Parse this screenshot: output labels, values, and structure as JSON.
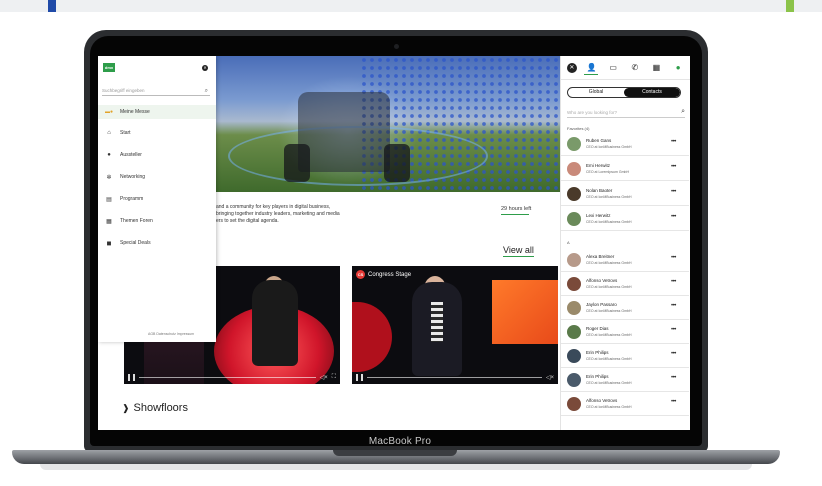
{
  "device": {
    "label": "MacBook Pro"
  },
  "menu": {
    "search_placeholder": "Suchbegriff eingeben",
    "items": [
      {
        "label": "Meine Messe",
        "icon": "ticket-icon"
      },
      {
        "label": "Start",
        "icon": "home-icon"
      },
      {
        "label": "Aussteller",
        "icon": "location-pin-icon"
      },
      {
        "label": "Networking",
        "icon": "network-icon"
      },
      {
        "label": "Programm",
        "icon": "document-icon"
      },
      {
        "label": "Themen Foren",
        "icon": "building-icon"
      },
      {
        "label": "Special Deals",
        "icon": "gift-icon"
      }
    ],
    "footer": "AGB  Datenschutz  Impressum"
  },
  "main": {
    "intro_lines": [
      "and a community for key players in digital business,",
      "bringing together industry leaders, marketing and media",
      "ers to set the digital agenda."
    ],
    "hours_left": "29 hours left",
    "view_all": "View all",
    "videos": [
      {
        "badge": ""
      },
      {
        "badge_code": "CS",
        "badge": "Congress Stage"
      }
    ],
    "section_title": "Showfloors"
  },
  "right_panel": {
    "toggle": {
      "global": "Global",
      "contacts": "Contacts"
    },
    "search_placeholder": "Who are you looking for?",
    "favorites_label": "Favorites (4)",
    "a_label": "A",
    "favorites": [
      {
        "name": "Ruben Gans",
        "company": "CEO at IonMBusiness GmbH",
        "avatar": "#7a9a6a"
      },
      {
        "name": "Emi Herwitz",
        "company": "CEO at LoremIpsum GmbH",
        "avatar": "#c98a7a"
      },
      {
        "name": "Nolan Baoter",
        "company": "CEO at IonMBusiness GmbH",
        "avatar": "#4a3a2a"
      },
      {
        "name": "Lexi Herwitz",
        "company": "CEO at IonMBusiness GmbH",
        "avatar": "#6a8a5a"
      }
    ],
    "contacts": [
      {
        "name": "Alexa Breitner",
        "company": "CEO at IonMBusiness GmbH",
        "avatar": "#b79a8a"
      },
      {
        "name": "Alfonso Vetrovs",
        "company": "CEO at IonMBusiness GmbH",
        "avatar": "#7a4a3a"
      },
      {
        "name": "Jaylon Passaro",
        "company": "CEO at IonMBusiness GmbH",
        "avatar": "#9a8a6a"
      },
      {
        "name": "Roger Dias",
        "company": "CEO at IonMBusiness GmbH",
        "avatar": "#5a7a4a"
      },
      {
        "name": "Erin Philips",
        "company": "CEO at IonMBusiness GmbH",
        "avatar": "#3a4a5a"
      },
      {
        "name": "Erin Philips",
        "company": "CEO at IonMBusiness GmbH",
        "avatar": "#4a5a6a"
      },
      {
        "name": "Alfonso Vetrovs",
        "company": "CEO at IonMBusiness GmbH",
        "avatar": "#7a4a3a"
      }
    ]
  },
  "colors": {
    "accent_green": "#2e9d4a",
    "accent_blue": "#1f4aa8"
  }
}
